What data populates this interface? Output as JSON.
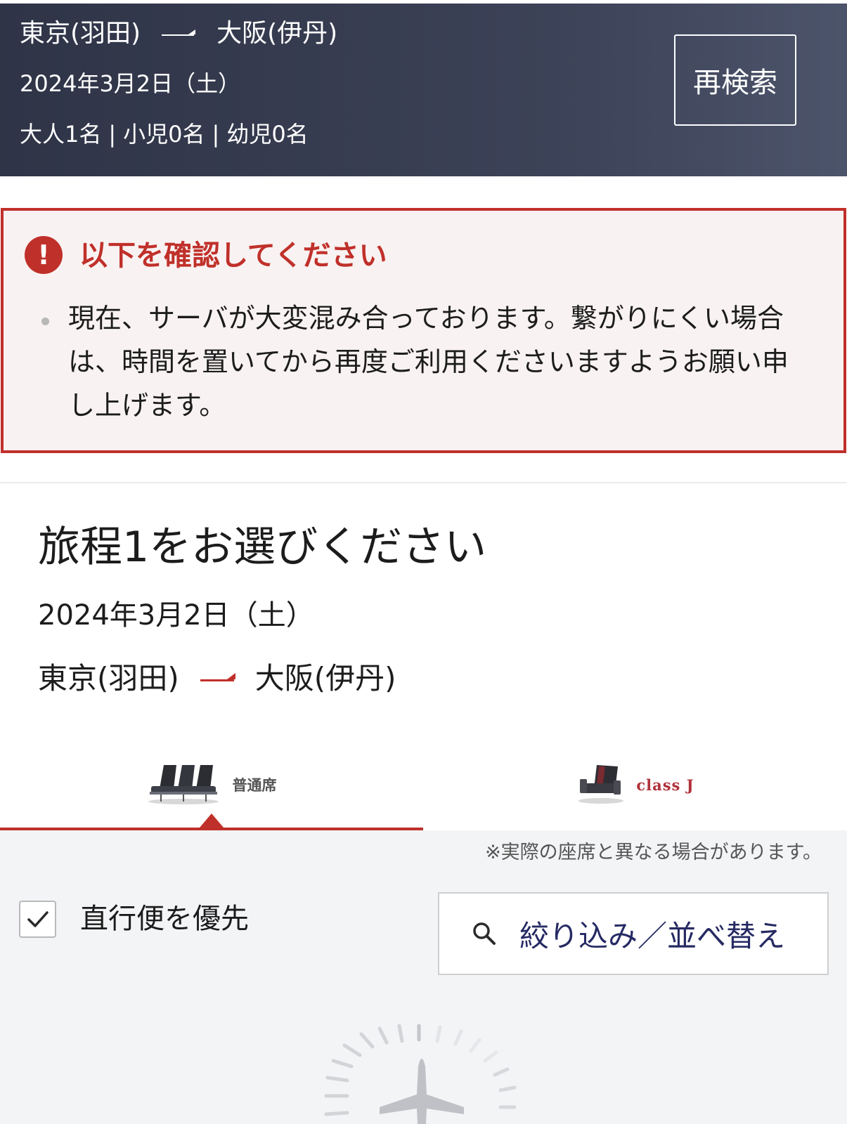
{
  "search_summary": {
    "origin": "東京(羽田)",
    "destination": "大阪(伊丹)",
    "date": "2024年3月2日（土）",
    "adults": "大人1名",
    "children": "小児0名",
    "infants": "幼児0名",
    "separator": "|",
    "research_label": "再検索"
  },
  "alert": {
    "icon": "exclamation-icon",
    "title": "以下を確認してください",
    "message": "現在、サーバが大変混み合っております。繋がりにくい場合は、時間を置いてから再度ご利用くださいますようお願い申し上げます。"
  },
  "itinerary": {
    "title": "旅程1をお選びください",
    "date": "2024年3月2日（土）",
    "origin": "東京(羽田)",
    "destination": "大阪(伊丹)"
  },
  "cabin_tabs": [
    {
      "label": "普通席",
      "icon": "economy-seat-icon",
      "selected": true
    },
    {
      "label": "class J",
      "icon": "classj-seat-icon",
      "selected": false
    }
  ],
  "seat_note": "※実際の座席と異なる場合があります。",
  "direct_flight": {
    "label": "直行便を優先",
    "checked": true
  },
  "filter": {
    "label": "絞り込み／並べ替え",
    "icon": "search-icon"
  },
  "colors": {
    "header_bg": "#3a4055",
    "accent_red": "#c0302a",
    "alert_bg": "#f9f2f2",
    "filter_text": "#262a63",
    "panel_bg": "#f3f4f6"
  }
}
